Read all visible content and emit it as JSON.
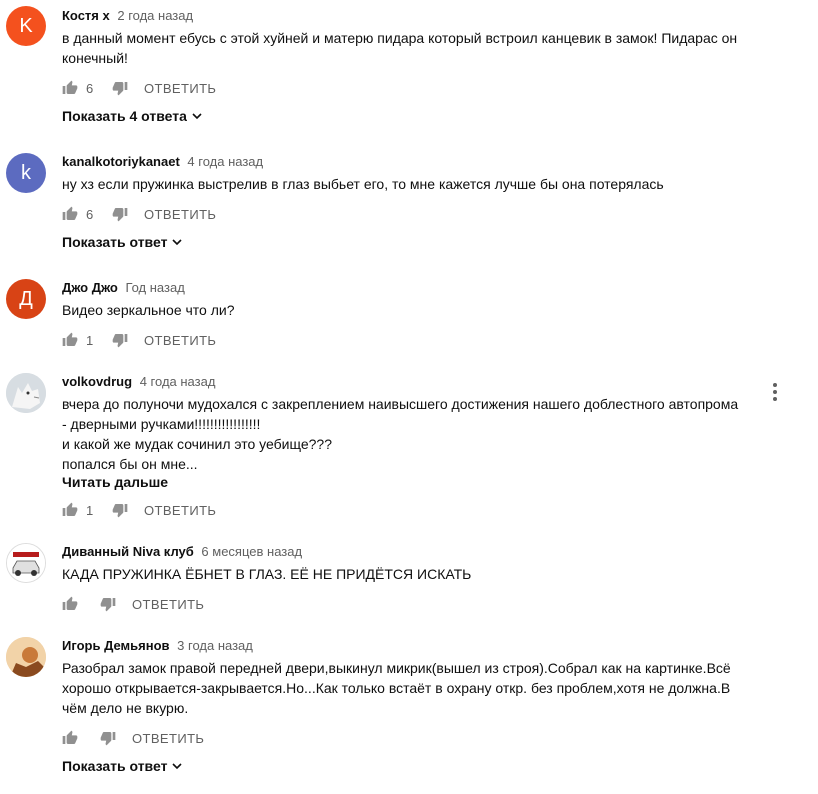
{
  "comments": [
    {
      "avatar_letter": "K",
      "avatar_color": "#f4511e",
      "author": "Костя х",
      "time": "2 года назад",
      "lines": [
        "в данный момент ебусь с этой хуйней и матерю пидара который встроил канцевик в замок! Пидарас он",
        "конечный!"
      ],
      "likes": "6",
      "reply_label": "ОТВЕТИТЬ",
      "show_replies": "Показать 4 ответа"
    },
    {
      "avatar_letter": "k",
      "avatar_color": "#5c6bc0",
      "author": "kanalkotoriykanaet",
      "time": "4 года назад",
      "lines": [
        "ну хз если пружинка выстрелив в глаз выбьет его, то мне кажется лучше бы она потерялась"
      ],
      "likes": "6",
      "reply_label": "ОТВЕТИТЬ",
      "show_replies": "Показать ответ"
    },
    {
      "avatar_letter": "Д",
      "avatar_color": "#d84315",
      "author": "Джо Джо",
      "time": "Год назад",
      "lines": [
        "Видео зеркальное что ли?"
      ],
      "likes": "1",
      "reply_label": "ОТВЕТИТЬ"
    },
    {
      "author": "volkovdrug",
      "time": "4 года назад",
      "lines": [
        "вчера до полуночи мудохался с закреплением наивысшего достижения нашего доблестного автопрома",
        "- дверными ручками!!!!!!!!!!!!!!!!!",
        "и какой же мудак сочинил это уебище???",
        "попался бы он мне..."
      ],
      "read_more": "Читать дальше",
      "likes": "1",
      "reply_label": "ОТВЕТИТЬ"
    },
    {
      "author": "Диванный Niva клуб",
      "time": "6 месяцев назад",
      "lines": [
        "КАДА ПРУЖИНКА ЁБНЕТ В ГЛАЗ. ЕЁ НЕ ПРИДЁТСЯ ИСКАТЬ"
      ],
      "reply_label": "ОТВЕТИТЬ"
    },
    {
      "author": "Игорь Демьянов",
      "time": "3 года назад",
      "lines": [
        "Разобрал замок правой передней двери,выкинул микрик(вышел из строя).Собрал как на картинке.Всё",
        "хорошо открывается-закрывается.Но...Как только встаёт в охрану откр. без проблем,хотя не должна.В",
        "чём дело не вкурю."
      ],
      "reply_label": "ОТВЕТИТЬ",
      "show_replies": "Показать ответ"
    }
  ]
}
